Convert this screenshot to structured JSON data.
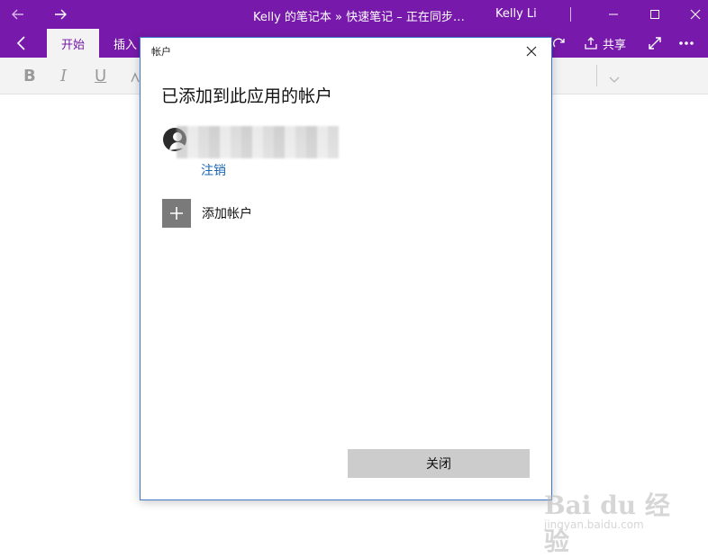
{
  "titlebar": {
    "title": "Kelly 的笔记本 » 快速笔记 – 正在同步…",
    "user": "Kelly Li",
    "icons": [
      "back-arrow-icon",
      "forward-arrow-icon",
      "minimize-icon",
      "maximize-icon",
      "close-icon"
    ]
  },
  "ribbon": {
    "tabs": [
      {
        "label": "开始",
        "active": true
      },
      {
        "label": "插入",
        "active": false
      }
    ],
    "share_label": "共享"
  },
  "toolbar": {
    "bold": "B",
    "italic": "I",
    "underline": "U"
  },
  "dialog": {
    "title": "帐户",
    "heading": "已添加到此应用的帐户",
    "signout_label": "注销",
    "add_account_label": "添加帐户",
    "close_button_label": "关闭"
  },
  "watermark": {
    "main": "Bai du 经验",
    "sub": "jingyan.baidu.com"
  },
  "colors": {
    "brand": "#7719aa",
    "link": "#1a67b3",
    "dialog_border": "#3d78c8",
    "button_bg": "#cccccc"
  }
}
